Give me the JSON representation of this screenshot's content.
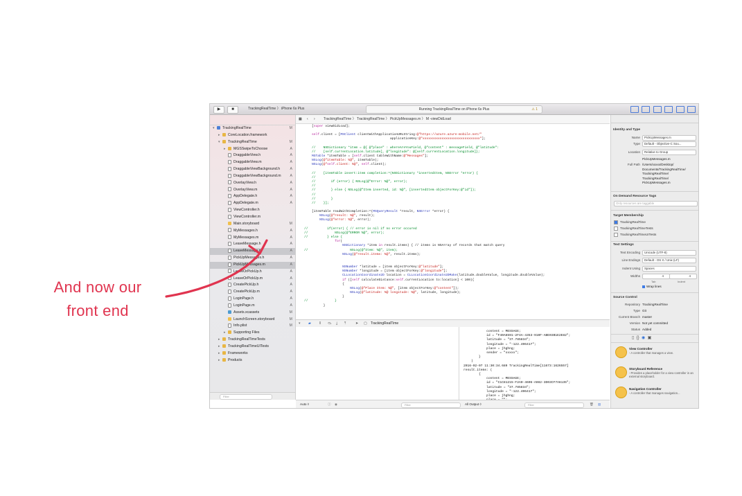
{
  "annotation": {
    "line1": "And now our",
    "line2": "front end",
    "color": "#e0344f"
  },
  "toolbar": {
    "scheme": "TrackingRealTime",
    "device": "iPhone 6s Plus",
    "status": "Running TrackingRealTime on iPhone 6s Plus",
    "warning": "⚠ 1"
  },
  "jumpbar": {
    "crumbs": "TrackingRealTime  〉 TrackingRealTime  〉 PickUpMessages.m  〉 M -viewDidLoad"
  },
  "navigator": {
    "items": [
      {
        "label": "TrackingRealTime",
        "badge": "M",
        "icon": "proj",
        "indent": 0,
        "disclosure": "▾"
      },
      {
        "label": "CoreLocation.framework",
        "badge": "",
        "icon": "folder",
        "indent": 1,
        "disclosure": "▸"
      },
      {
        "label": "TrackingRealTime",
        "badge": "M",
        "icon": "folder",
        "indent": 1,
        "disclosure": "▾"
      },
      {
        "label": "MGSSwipeToChoose",
        "badge": "A",
        "icon": "folder",
        "indent": 2,
        "disclosure": "▸"
      },
      {
        "label": "DraggableView.h",
        "badge": "A",
        "icon": "file",
        "indent": 2,
        "disclosure": ""
      },
      {
        "label": "DraggableView.m",
        "badge": "A",
        "icon": "file",
        "indent": 2,
        "disclosure": ""
      },
      {
        "label": "DraggableViewBackground.h",
        "badge": "A",
        "icon": "file",
        "indent": 2,
        "disclosure": ""
      },
      {
        "label": "DraggableViewBackground.m",
        "badge": "A",
        "icon": "file",
        "indent": 2,
        "disclosure": ""
      },
      {
        "label": "OverlayView.h",
        "badge": "A",
        "icon": "file",
        "indent": 2,
        "disclosure": ""
      },
      {
        "label": "OverlayView.m",
        "badge": "A",
        "icon": "file",
        "indent": 2,
        "disclosure": ""
      },
      {
        "label": "AppDelegate.h",
        "badge": "A",
        "icon": "file",
        "indent": 2,
        "disclosure": ""
      },
      {
        "label": "AppDelegate.m",
        "badge": "A",
        "icon": "file",
        "indent": 2,
        "disclosure": ""
      },
      {
        "label": "ViewController.h",
        "badge": "",
        "icon": "file",
        "indent": 2,
        "disclosure": ""
      },
      {
        "label": "ViewController.m",
        "badge": "",
        "icon": "file",
        "indent": 2,
        "disclosure": ""
      },
      {
        "label": "Main.storyboard",
        "badge": "M",
        "icon": "story",
        "indent": 2,
        "disclosure": ""
      },
      {
        "label": "MyMessages.h",
        "badge": "A",
        "icon": "file",
        "indent": 2,
        "disclosure": ""
      },
      {
        "label": "MyMessages.m",
        "badge": "A",
        "icon": "file",
        "indent": 2,
        "disclosure": ""
      },
      {
        "label": "LeaveMessage.h",
        "badge": "A",
        "icon": "file",
        "indent": 2,
        "disclosure": ""
      },
      {
        "label": "LeaveMessage.m",
        "badge": "A",
        "icon": "file",
        "indent": 2,
        "disclosure": "",
        "selected": true
      },
      {
        "label": "PickUpMessages.h",
        "badge": "A",
        "icon": "file",
        "indent": 2,
        "disclosure": ""
      },
      {
        "label": "PickUpMessages.m",
        "badge": "A",
        "icon": "file",
        "indent": 2,
        "disclosure": "",
        "selected": true
      },
      {
        "label": "LeaveOrPickUp.h",
        "badge": "A",
        "icon": "file",
        "indent": 2,
        "disclosure": ""
      },
      {
        "label": "LeaveOrPickUp.m",
        "badge": "A",
        "icon": "file",
        "indent": 2,
        "disclosure": ""
      },
      {
        "label": "CreatePickUp.h",
        "badge": "A",
        "icon": "file",
        "indent": 2,
        "disclosure": ""
      },
      {
        "label": "CreatePickUp.m",
        "badge": "A",
        "icon": "file",
        "indent": 2,
        "disclosure": ""
      },
      {
        "label": "LoginPage.h",
        "badge": "A",
        "icon": "file",
        "indent": 2,
        "disclosure": ""
      },
      {
        "label": "LoginPage.m",
        "badge": "A",
        "icon": "file",
        "indent": 2,
        "disclosure": ""
      },
      {
        "label": "Assets.xcassets",
        "badge": "M",
        "icon": "asset",
        "indent": 2,
        "disclosure": ""
      },
      {
        "label": "LaunchScreen.storyboard",
        "badge": "M",
        "icon": "story",
        "indent": 2,
        "disclosure": ""
      },
      {
        "label": "Info.plist",
        "badge": "M",
        "icon": "file",
        "indent": 2,
        "disclosure": ""
      },
      {
        "label": "Supporting Files",
        "badge": "",
        "icon": "folder",
        "indent": 2,
        "disclosure": "▸"
      },
      {
        "label": "TrackingRealTimeTests",
        "badge": "",
        "icon": "folder",
        "indent": 1,
        "disclosure": "▸"
      },
      {
        "label": "TrackingRealTimeUITests",
        "badge": "",
        "icon": "folder",
        "indent": 1,
        "disclosure": "▸"
      },
      {
        "label": "Frameworks",
        "badge": "",
        "icon": "folder",
        "indent": 1,
        "disclosure": "▸"
      },
      {
        "label": "Products",
        "badge": "",
        "icon": "folder",
        "indent": 1,
        "disclosure": "▸"
      }
    ]
  },
  "code": [
    {
      "t": "    [super viewDidLoad];",
      "c": ""
    },
    {
      "t": "",
      "c": ""
    },
    {
      "t": "    self.client = [MSClient clientWithApplicationURLString:@\"https://azure.azure-mobile.net/\"",
      "c": ""
    },
    {
      "t": "                                             applicationKey:@\"xxxxxxxxxxxxxxxxxxxxxxxxxxxxxx\"];",
      "c": ""
    },
    {
      "t": "",
      "c": ""
    },
    {
      "t": "    //    NSDictionary *item = @{ @\"place\" : whereAreYouField, @\"content\" : messageField, @\"latitude\":",
      "c": "cm"
    },
    {
      "t": "    //    [self.currentLocation.latitude], @\"longitude\": @[self.currentLocation.longitude]};",
      "c": "cm"
    },
    {
      "t": "    MSTable *itemTable = [self.client tableWithName:@\"Messages\"];",
      "c": ""
    },
    {
      "t": "    NSLog(@\"itemTable: %@\", itemTable);",
      "c": ""
    },
    {
      "t": "    NSLog(@\"self.client: %@\", self.client);",
      "c": ""
    },
    {
      "t": "",
      "c": ""
    },
    {
      "t": "    //    [itemTable insert:item completion:^(NSDictionary *insertedItem, NSError *error) {",
      "c": "cm"
    },
    {
      "t": "    //",
      "c": "cm"
    },
    {
      "t": "    //        if (error) { NSLog(@\"Error: %@\", error);",
      "c": "cm"
    },
    {
      "t": "    //",
      "c": "cm"
    },
    {
      "t": "    //        } else { NSLog(@\"Item inserted, id: %@\", [insertedItem objectForKey:@\"id\"]);",
      "c": "cm"
    },
    {
      "t": "    //",
      "c": "cm"
    },
    {
      "t": "    //        }",
      "c": "cm"
    },
    {
      "t": "    //    }];",
      "c": "cm"
    },
    {
      "t": "",
      "c": ""
    },
    {
      "t": "    [itemTable readWithCompletion:^(MSQueryResult *result, NSError *error) {",
      "c": ""
    },
    {
      "t": "        NSLog(@\"result: %@\", result);",
      "c": ""
    },
    {
      "t": "        NSLog(@\"error: %@\", error);",
      "c": ""
    },
    {
      "t": "",
      "c": ""
    },
    {
      "t": "//          if(error) { // error is nil if no error occured",
      "c": "cm"
    },
    {
      "t": "//              NSLog(@\"ERROR %@\", error);",
      "c": "cm"
    },
    {
      "t": "//          } else {",
      "c": "cm"
    },
    {
      "t": "                for(",
      "c": ""
    },
    {
      "t": "                    NSDictionary *item in result.items) { // items is NSArray of records that match query",
      "c": ""
    },
    {
      "t": "//                      NSLog(@\"Item: %@\", item);",
      "c": "cm"
    },
    {
      "t": "                    NSLog(@\"result.items: %@\", result.items);",
      "c": ""
    },
    {
      "t": "",
      "c": ""
    },
    {
      "t": "",
      "c": ""
    },
    {
      "t": "                    NSNumber *latitude = [item objectForKey:@\"latitude\"];",
      "c": ""
    },
    {
      "t": "                    NSNumber *longitude = [item objectForKey:@\"longitude\"];",
      "c": ""
    },
    {
      "t": "                    CLLocationCoordinate2D location = CLLocationCoordinate2DMake(latitude.doubleValue, longitude.doubleValue);",
      "c": ""
    },
    {
      "t": "                    if ([self calculateDistance:self.currentLocation to:location] < 100){",
      "c": ""
    },
    {
      "t": "                    {",
      "c": ""
    },
    {
      "t": "                        NSLog(@\"Place Item: %@\", [item objectForKey:@\"content\"]);",
      "c": ""
    },
    {
      "t": "                        NSLog(@\"latitude: %@ longitude: %@\", latitude, longitude);",
      "c": ""
    },
    {
      "t": "                    }",
      "c": ""
    },
    {
      "t": "//              }",
      "c": "cm"
    },
    {
      "t": "          }",
      "c": ""
    }
  ],
  "debug": {
    "target": "TrackingRealTime",
    "auto_label": "Auto ◊",
    "output_label": "All Output ◊",
    "filter_placeholder": "Filter"
  },
  "console_lines": [
    "            content = MESSAGE;",
    "            id = \"F40A6591-2F4A-4353-910F-ABE03B1E2E82\";",
    "            latitude = \"37.785834\";",
    "            longitude = \"-122.406417\";",
    "            place = jhghng;",
    "            sender = \"xxxxx\";",
    "        }",
    "    )",
    "2016-02-07 11:30:34.689 TrackingRealTime[11673:1626557]",
    "result.items: (",
    "        {",
    "            content = MESSAGE;",
    "            id = \"C1C81215-F2A0-4606-A982-3D03CF7A6135\";",
    "            latitude = \"37.785834\";",
    "            longitude = \"-122.406417\";",
    "            place = jhghng;",
    "            place = \"\";"
  ],
  "inspector": {
    "identity_title": "Identity and Type",
    "name_label": "Name",
    "name_value": "PickUpMessages.m",
    "type_label": "Type",
    "type_value": "Default - Objective-C Sou...",
    "location_label": "Location",
    "location_value": "Relative to Group",
    "location_file": "PickUpMessages.m",
    "fullpath_label": "Full Path",
    "fullpath_lines": [
      "/Users/xxxxx/Desktop/",
      "Documents/TrackingRealTime/",
      "TrackingRealTime/",
      "TrackingRealTime/",
      "PickUpMessages.m"
    ],
    "odr_title": "On Demand Resource Tags",
    "odr_placeholder": "Only resources are taggable",
    "membership_title": "Target Membership",
    "targets": [
      {
        "label": "TrackingRealTime",
        "checked": true
      },
      {
        "label": "TrackingRealTimeTests",
        "checked": false
      },
      {
        "label": "TrackingRealTimeUITests",
        "checked": false
      }
    ],
    "text_title": "Text Settings",
    "encoding_label": "Text Encoding",
    "encoding_value": "Unicode (UTF-8)",
    "endings_label": "Line Endings",
    "endings_value": "Default - OS X / Unix (LF)",
    "indent_label": "Indent Using",
    "indent_value": "Spaces",
    "widths_label": "Widths",
    "tab_value": "4",
    "indent_width_value": "4",
    "tab_label": "Tab",
    "indent_label2": "Indent",
    "wrap_label": "Wrap lines",
    "source_title": "Source Control",
    "repo_label": "Repository",
    "repo_value": "TrackingRealTime",
    "vtype_label": "Type",
    "vtype_value": "Git",
    "branch_label": "Current Branch",
    "branch_value": "master",
    "version_label": "Version",
    "version_value": "Not yet committed",
    "vstatus_label": "Status",
    "vstatus_value": "Added",
    "library": [
      {
        "title": "View Controller",
        "desc": "- A controller that",
        "desc2": "manages a view."
      },
      {
        "title": "Storyboard Reference",
        "desc": "- Provides a",
        "desc2": "placeholder for a view controller in an external storyboard."
      },
      {
        "title": "Navigation Controller",
        "desc": "- A",
        "desc2": "controller that manages navigation..."
      }
    ]
  }
}
